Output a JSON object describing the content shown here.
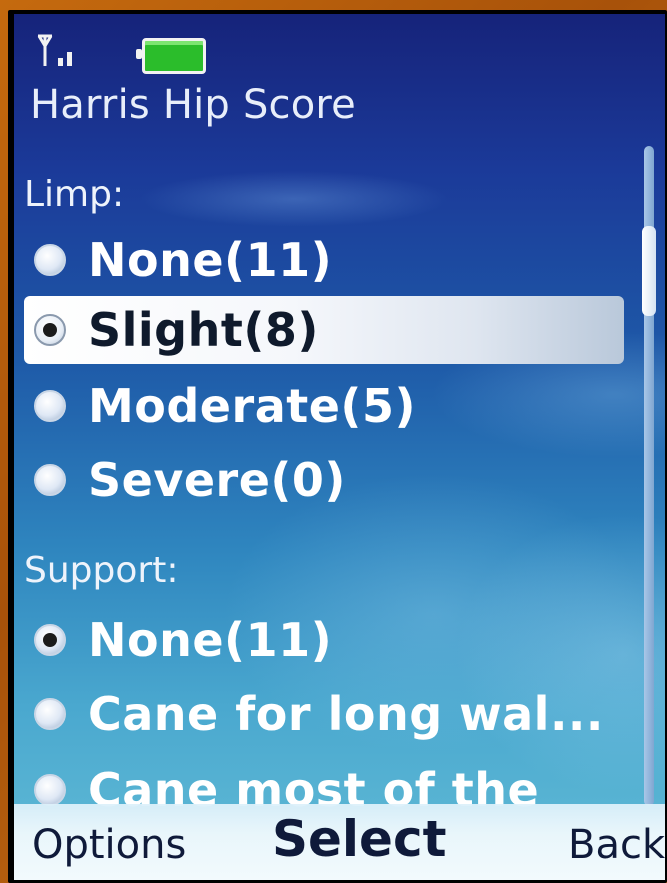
{
  "status": {
    "signal_icon": "signal-strength-icon",
    "battery_icon": "battery-icon"
  },
  "app": {
    "title": "Harris Hip Score"
  },
  "sections": [
    {
      "label": "Limp:",
      "options": [
        {
          "label": "None(11)",
          "selected": false
        },
        {
          "label": "Slight(8)",
          "selected": true
        },
        {
          "label": "Moderate(5)",
          "selected": false
        },
        {
          "label": "Severe(0)",
          "selected": false
        }
      ]
    },
    {
      "label": "Support:",
      "options": [
        {
          "label": "None(11)",
          "selected": true
        },
        {
          "label": "Cane for long wal...",
          "selected": false
        },
        {
          "label": "Cane most of the",
          "selected": false
        }
      ]
    }
  ],
  "softkeys": {
    "left": "Options",
    "middle": "Select",
    "right": "Back"
  },
  "colors": {
    "highlight": "#ffffff",
    "background_top": "#16237a",
    "background_bottom": "#62bcd6"
  }
}
